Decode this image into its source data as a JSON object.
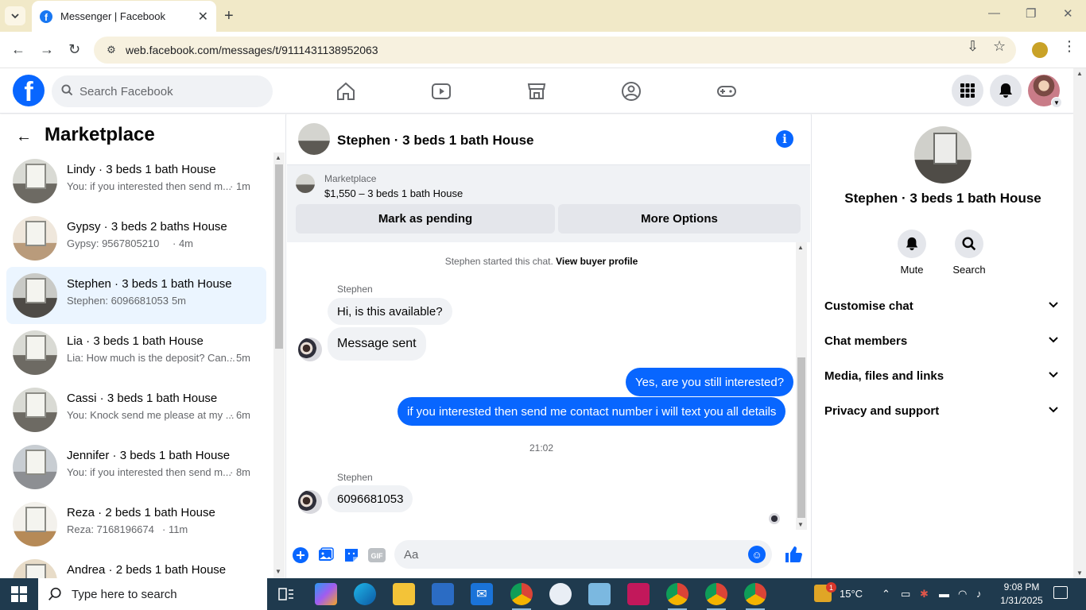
{
  "browser": {
    "tab_title": "Messenger | Facebook",
    "url": "web.facebook.com/messages/t/9111431138952063"
  },
  "fb": {
    "search_placeholder": "Search Facebook"
  },
  "left": {
    "title": "Marketplace",
    "chats": [
      {
        "name": "Lindy · 3 beds 1 bath House",
        "snippet": "You: if you interested then send m...",
        "time": "· 1m"
      },
      {
        "name": "Gypsy · 3 beds 2 baths House",
        "snippet": "Gypsy: 9567805210",
        "time": "· 4m"
      },
      {
        "name": "Stephen · 3 beds 1 bath House",
        "snippet": "Stephen: 6096681053",
        "time": "· 5m"
      },
      {
        "name": "Lia · 3 beds 1 bath House",
        "snippet": "Lia: How much is the deposit? Can...",
        "time": "· 5m"
      },
      {
        "name": "Cassi · 3 beds 1 bath House",
        "snippet": "You: Knock send me please at my ...",
        "time": "· 6m"
      },
      {
        "name": "Jennifer · 3 beds 1 bath House",
        "snippet": "You: if you interested then send m...",
        "time": "· 8m"
      },
      {
        "name": "Reza · 2 beds 1 bath House",
        "snippet": "Reza: 7168196674",
        "time": "· 11m"
      },
      {
        "name": "Andrea · 2 beds 1 bath House",
        "snippet": "",
        "time": ""
      }
    ]
  },
  "conversation": {
    "title": "Stephen · 3 beds 1 bath House",
    "marketplace_label": "Marketplace",
    "listing": "$1,550 – 3 beds 1 bath House",
    "mark_pending": "Mark as pending",
    "more_options": "More Options",
    "system_text": "Stephen started this chat.",
    "system_link": "View buyer profile",
    "sender": "Stephen",
    "msg1": "Hi, is this available?",
    "msg2": "Message sent",
    "out1": "Yes, are you still interested?",
    "out2": "if you interested then send me contact number i will text you all details",
    "timestamp": "21:02",
    "msg3": "6096681053",
    "composer_placeholder": "Aa"
  },
  "right": {
    "name": "Stephen · 3 beds 1 bath House",
    "mute": "Mute",
    "search": "Search",
    "rows": [
      "Customise chat",
      "Chat members",
      "Media, files and links",
      "Privacy and support"
    ]
  },
  "taskbar": {
    "search_placeholder": "Type here to search",
    "temperature": "15°C",
    "time": "9:08 PM",
    "date": "1/31/2025",
    "weather_badge": "1"
  },
  "colors": {
    "fb_blue": "#0866ff",
    "active_chat_bg": "#ebf5ff",
    "taskbar": "#1f3a4e"
  }
}
